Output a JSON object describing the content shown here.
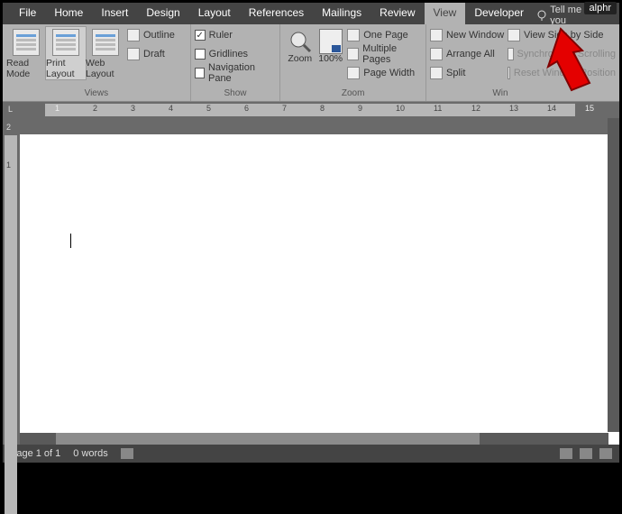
{
  "watermark": "alphr",
  "tabs": {
    "file": "File",
    "items": [
      "Home",
      "Insert",
      "Design",
      "Layout",
      "References",
      "Mailings",
      "Review",
      "View",
      "Developer"
    ],
    "active": "View",
    "tell_me": "Tell me what you"
  },
  "ribbon": {
    "views": {
      "label": "Views",
      "read_mode": "Read Mode",
      "print_layout": "Print Layout",
      "web_layout": "Web Layout",
      "outline": "Outline",
      "draft": "Draft"
    },
    "show": {
      "label": "Show",
      "ruler": "Ruler",
      "ruler_checked": "✓",
      "gridlines": "Gridlines",
      "nav_pane": "Navigation Pane"
    },
    "zoom": {
      "label": "Zoom",
      "zoom": "Zoom",
      "hundred": "100%",
      "one_page": "One Page",
      "multiple_pages": "Multiple Pages",
      "page_width": "Page Width"
    },
    "window": {
      "label": "Win",
      "new_window": "New Window",
      "arrange_all": "Arrange All",
      "split": "Split",
      "side_by_side": "View Side by Side",
      "sync_scroll": "Synchronous Scrolling",
      "reset_pos": "Reset Window Position"
    }
  },
  "ruler": {
    "h_nums": [
      "1",
      "2",
      "3",
      "4",
      "5",
      "6",
      "7",
      "8",
      "9",
      "10",
      "11",
      "12",
      "13",
      "14",
      "15"
    ],
    "left_marker": "L",
    "v_nums": [
      "2",
      "1"
    ]
  },
  "status": {
    "page": "Page 1 of 1",
    "words": "0 words"
  }
}
